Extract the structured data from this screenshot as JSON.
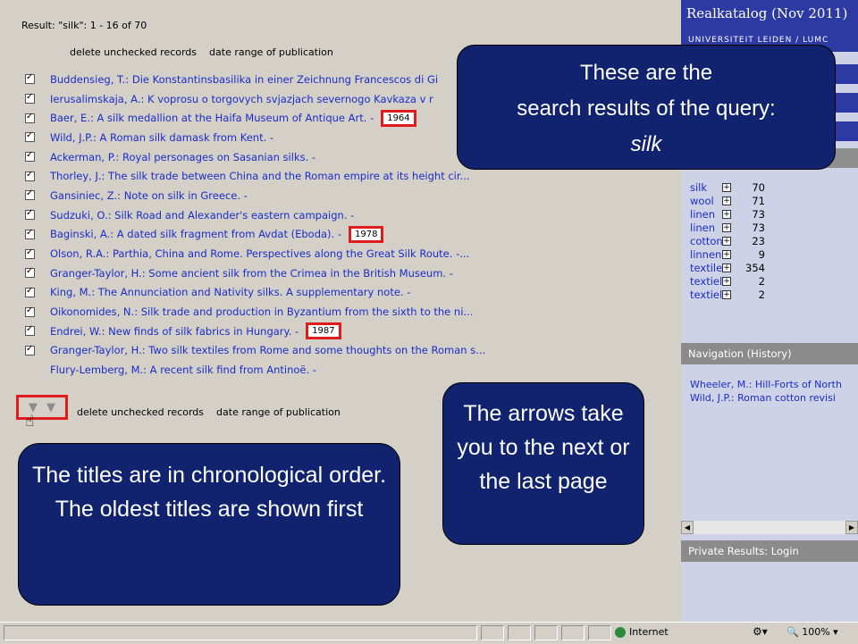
{
  "header": {
    "result_text": "Result: \"silk\": 1 - 16 of 70"
  },
  "actions": {
    "delete": "delete unchecked records",
    "date_range": "date range of publication"
  },
  "records": [
    {
      "text": "Buddensieg, T.: Die Konstantinsbasilika in einer Zeichnung Francescos di Gi",
      "checked": true,
      "year": ""
    },
    {
      "text": "Ierusalimskaja, A.: K voprosu o torgovych svjazjach severnogo Kavkaza v r",
      "checked": true,
      "year": ""
    },
    {
      "text": "Baer, E.: A silk medallion at the Haifa Museum of Antique Art. -",
      "checked": true,
      "year": "1964"
    },
    {
      "text": "Wild, J.P.: A Roman silk damask from Kent. -",
      "checked": true,
      "year": ""
    },
    {
      "text": "Ackerman, P.: Royal personages on Sasanian silks. -",
      "checked": true,
      "year": ""
    },
    {
      "text": "Thorley, J.: The silk trade between China and the Roman empire at its height cir...",
      "checked": true,
      "year": ""
    },
    {
      "text": "Gansiniec, Z.: Note on silk in Greece. -",
      "checked": true,
      "year": ""
    },
    {
      "text": "Sudzuki, O.: Silk Road and Alexander's eastern campaign. -",
      "checked": true,
      "year": ""
    },
    {
      "text": "Baginski, A.: A dated silk fragment from Avdat (Eboda). -",
      "checked": true,
      "year": "1978"
    },
    {
      "text": "Olson, R.A.: Parthia, China and Rome. Perspectives along the Great Silk Route. -...",
      "checked": true,
      "year": ""
    },
    {
      "text": "Granger-Taylor, H.: Some ancient silk from the Crimea in the British Museum. -",
      "checked": true,
      "year": ""
    },
    {
      "text": "King, M.: The Annunciation and Nativity silks. A supplementary note. -",
      "checked": true,
      "year": ""
    },
    {
      "text": "Oikonomides, N.: Silk trade and production in Byzantium from the sixth to the ni...",
      "checked": true,
      "year": ""
    },
    {
      "text": "Endrei, W.: New finds of silk fabrics in Hungary. -",
      "checked": true,
      "year": "1987"
    },
    {
      "text": "Granger-Taylor, H.: Two silk textiles from Rome and some thoughts on the Roman s...",
      "checked": true,
      "year": ""
    },
    {
      "text": "Flury-Lemberg, M.: A recent silk find from Antinoë. -",
      "checked": false,
      "year": ""
    }
  ],
  "sidebar": {
    "title": "Realkatalog (Nov 2011)",
    "subtitle": "UNIVERSITEIT LEIDEN / LUMC",
    "terms": [
      {
        "name": "silk",
        "count": "70"
      },
      {
        "name": "wool",
        "count": "71"
      },
      {
        "name": "linen",
        "count": "73"
      },
      {
        "name": "linen",
        "count": "73"
      },
      {
        "name": "cotton",
        "count": "23"
      },
      {
        "name": "linnen",
        "count": "9"
      },
      {
        "name": "textile",
        "count": "354"
      },
      {
        "name": "textiel",
        "count": "2"
      },
      {
        "name": "textiel",
        "count": "2"
      }
    ],
    "nav_header": "Navigation (History)",
    "nav_items": [
      "Wheeler, M.: Hill-Forts of North",
      "Wild, J.P.: Roman cotton revisi"
    ],
    "private_header": "Private Results: Login"
  },
  "callouts": {
    "results_l1": "These are the",
    "results_l2": "search results of the query:",
    "results_l3": "silk",
    "arrows_text": "The arrows take you to the next or the last page",
    "chrono_text": "The titles are in chronological order. The oldest titles are shown first"
  },
  "statusbar": {
    "zone": "Internet",
    "zoom": "100%"
  },
  "colors": {
    "link": "#1a2dc8",
    "callout_bg": "#11226e",
    "highlight": "#e01b1b",
    "sidebar_header": "#2d3aa3"
  }
}
